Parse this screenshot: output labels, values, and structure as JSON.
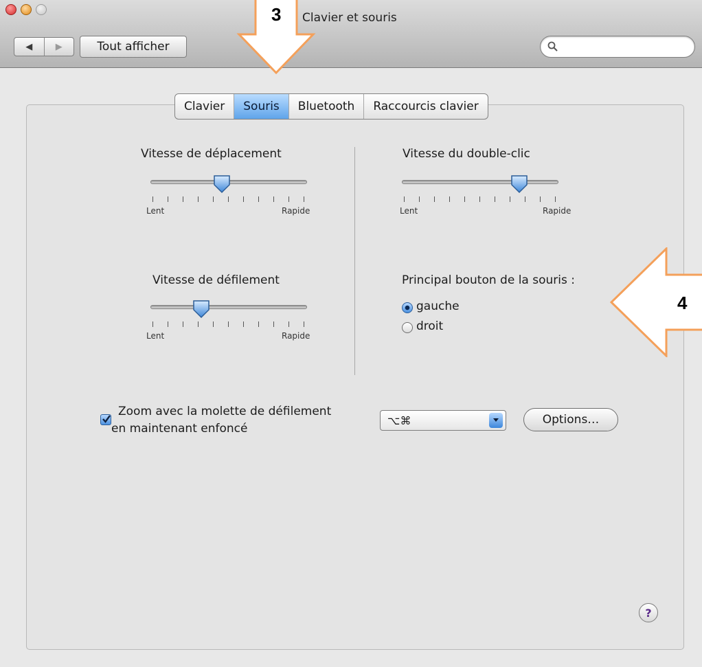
{
  "window": {
    "title": "Clavier et souris"
  },
  "toolbar": {
    "back_label": "◀",
    "forward_label": "▶",
    "show_all_label": "Tout afficher",
    "search_placeholder": "",
    "search_icon": "magnifier-icon"
  },
  "tabs": [
    {
      "label": "Clavier",
      "selected": false
    },
    {
      "label": "Souris",
      "selected": true
    },
    {
      "label": "Bluetooth",
      "selected": false
    },
    {
      "label": "Raccourcis clavier",
      "selected": false
    }
  ],
  "tracking_speed": {
    "title": "Vitesse de déplacement",
    "min_label": "Lent",
    "max_label": "Rapide",
    "value": 0.45
  },
  "scroll_speed": {
    "title": "Vitesse de défilement",
    "min_label": "Lent",
    "max_label": "Rapide",
    "value": 0.3
  },
  "double_click_speed": {
    "title": "Vitesse du double-clic",
    "min_label": "Lent",
    "max_label": "Rapide",
    "value": 0.78
  },
  "primary_button": {
    "title": "Principal bouton de la souris :",
    "options": [
      {
        "label": "gauche",
        "selected": true
      },
      {
        "label": "droit",
        "selected": false
      }
    ]
  },
  "zoom": {
    "checked": true,
    "line1": "Zoom avec la molette de défilement",
    "line2": "en maintenant enfoncé",
    "modifier_value": "⌥⌘",
    "options_label": "Options…"
  },
  "help_label": "?",
  "annotations": {
    "step3": "3",
    "step4": "4",
    "color": "#f4a05a"
  },
  "colors": {
    "accent": "#5fa4ea"
  }
}
